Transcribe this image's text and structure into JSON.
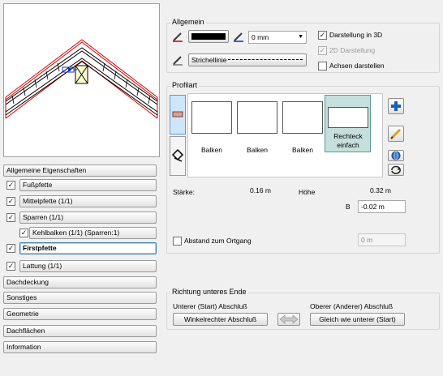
{
  "nav": {
    "section_label": "Allgemeine Eigenschaften",
    "items": [
      {
        "label": "Fußpfette",
        "checked": true
      },
      {
        "label": "Mittelpfette (1/1)",
        "checked": true
      },
      {
        "label": "Sparren (1/1)",
        "checked": true
      },
      {
        "label": "Kehlbalken (1/1) (Sparren:1)",
        "checked": true
      },
      {
        "label": "Firstpfette",
        "checked": true,
        "selected": true
      },
      {
        "label": "Lattung (1/1)",
        "checked": true
      }
    ],
    "bottom_items": [
      "Dachdeckung",
      "Sonstiges",
      "Geometrie",
      "Dachflächen",
      "Information"
    ]
  },
  "allgemein": {
    "title": "Allgemein",
    "pen_color": "#000000",
    "line_width": "0 mm",
    "line_style_label": "Strichellinie",
    "darstellung_3d": {
      "label": "Darstellung in 3D",
      "checked": true
    },
    "darstellung_2d": {
      "label": "2D Darstellung",
      "checked": true,
      "disabled": true
    },
    "achsen": {
      "label": "Achsen darstellen",
      "checked": false
    }
  },
  "profilart": {
    "title": "Profilart",
    "tiles": [
      "Balken",
      "Balken",
      "Balken",
      "Rechteck einfach"
    ],
    "selected_index": 3,
    "staerke_label": "Stärke:",
    "staerke_value": "0.16 m",
    "hoehe_label": "Höhe",
    "hoehe_value": "0.32 m",
    "b_label": "B",
    "b_value": "-0.02 m",
    "ortgang_label": "Abstand zum Ortgang",
    "ortgang_value": "0 m"
  },
  "richtung": {
    "title": "Richtung unteres Ende",
    "lower_label": "Unterer (Start) Abschluß",
    "lower_button": "Winkelrechter Abschluß",
    "upper_label": "Oberer (Anderer) Abschluß",
    "upper_button": "Gleich wie unterer (Start)"
  },
  "colors": {
    "accent": "#3c7fb1",
    "selected_tile_bg": "#c5e0dc",
    "roof_red": "#d40000"
  }
}
